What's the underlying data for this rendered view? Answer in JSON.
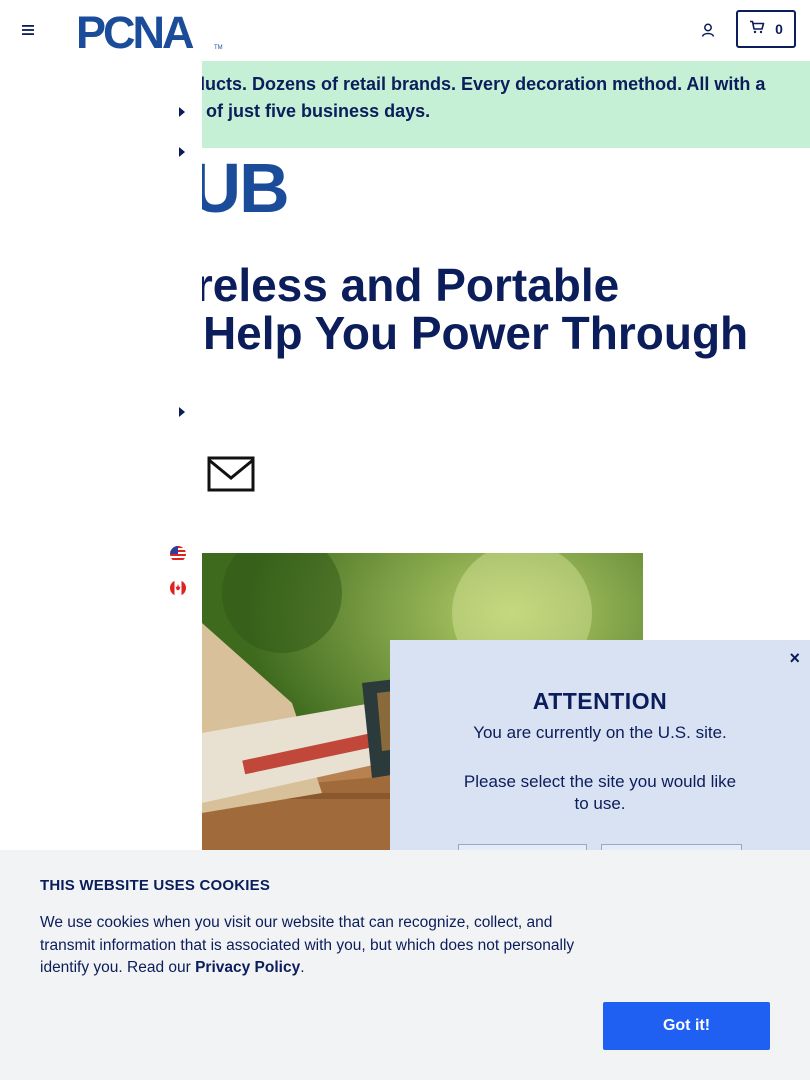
{
  "header": {
    "logo_text": "PCNA",
    "logo_tm": "TM",
    "cart_count": "0",
    "menu_icon": "hamburger-icon",
    "account_icon": "user-icon",
    "cart_icon": "cart-icon"
  },
  "banner": {
    "text": "Thousands of products. Dozens of retail brands. Every decoration method. All with a standard lead time of just five business days."
  },
  "hub_logo_text": "HUB",
  "article": {
    "title": "The Best Wireless and Portable Chargers to Help You Power Through Your Day"
  },
  "region_flags": [
    "us-flag-icon",
    "canada-flag-icon"
  ],
  "modal": {
    "close_label": "×",
    "title": "ATTENTION",
    "current_site": "You are currently on the U.S. site.",
    "prompt": "Please select the site you would like to use."
  },
  "cookie": {
    "title": "THIS WEBSITE USES COOKIES",
    "body_prefix": "We use cookies when you visit our website that can recognize, collect, and transmit information that is associated with you, but which does not personally identify you. Read our ",
    "privacy_link": "Privacy Policy",
    "body_suffix": ".",
    "accept_label": "Got it!"
  },
  "colors": {
    "navy": "#0b1d5a",
    "banner_bg": "#c6f0d6",
    "modal_bg": "#d9e2f3",
    "cookie_bg": "#f2f3f5",
    "accept_button": "#1f5ff2",
    "logo_blue": "#1a4c9a"
  }
}
